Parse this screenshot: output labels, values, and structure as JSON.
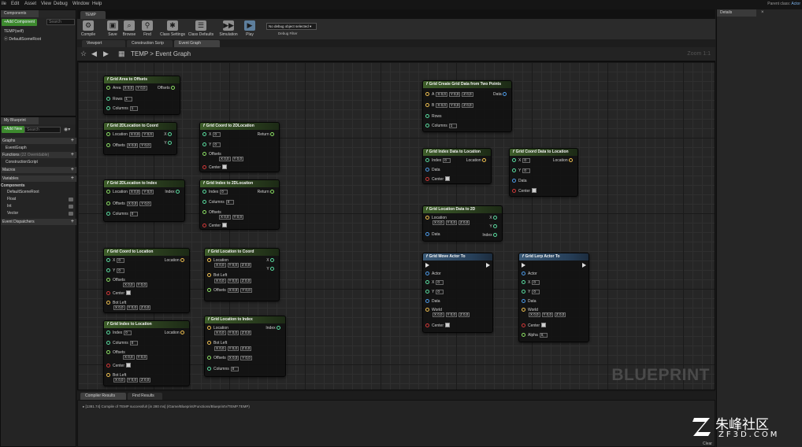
{
  "menu": [
    "ile",
    "Edit",
    "Asset",
    "View",
    "Debug",
    "Window",
    "Help"
  ],
  "title_right": {
    "label": "Parent class:",
    "value": "Actor"
  },
  "components_panel": {
    "tab": "Components",
    "add_button": "+Add Component",
    "search_placeholder": "Search",
    "items": [
      "TEMP(self)",
      "DefaultSceneRoot"
    ]
  },
  "myblueprint_panel": {
    "tab": "My Blueprint",
    "add_button": "+Add New",
    "search_placeholder": "Search",
    "sections": {
      "graphs": "Graphs",
      "event_graph": "EventGraph",
      "functions": "Functions",
      "functions_count": "(22 Overridable)",
      "construction_script": "ConstructionScript",
      "macros": "Macros",
      "variables": "Variables",
      "components": "Components",
      "default_scene_root": "DefaultSceneRoot",
      "var_float": "Float",
      "var_int": "Int",
      "var_vector": "Vector",
      "event_dispatchers": "Event Dispatchers"
    }
  },
  "editor_tab": "TEMP",
  "toolbar": [
    {
      "icon": "compile-icon",
      "label": "Compile"
    },
    {
      "icon": "save-icon",
      "label": "Save"
    },
    {
      "icon": "browse-icon",
      "label": "Browse"
    },
    {
      "icon": "find-icon",
      "label": "Find"
    },
    {
      "icon": "class-settings-icon",
      "label": "Class Settings"
    },
    {
      "icon": "class-defaults-icon",
      "label": "Class Defaults"
    },
    {
      "icon": "simulation-icon",
      "label": "Simulation"
    },
    {
      "icon": "play-icon",
      "label": "Play"
    }
  ],
  "debug": {
    "selected": "No debug object selected",
    "label": "Debug Filter"
  },
  "graph_tabs": [
    "Viewport",
    "Construction Scrip",
    "Event Graph"
  ],
  "breadcrumb": "TEMP > Event Graph",
  "zoom": "Zoom 1:1",
  "watermark": "BLUEPRINT",
  "nodes": {
    "area_to_offsets": {
      "title": "Grid Area to Offsets",
      "area": "Area",
      "area_x": "X 0,0",
      "area_y": "Y 0,0",
      "offsets": "Offsets",
      "rows": "Rows",
      "rows_v": "1",
      "columns": "Columns",
      "columns_v": "1"
    },
    "loc2d_to_coord": {
      "title": "Grid 2DLocation to Coord",
      "location": "Location",
      "loc_x": "X 0,0",
      "loc_y": "Y 0,0",
      "offsets": "Offsets",
      "off_x": "X 0,0",
      "off_y": "Y 0,0",
      "out_x": "X",
      "out_y": "Y"
    },
    "coord_to_2dloc": {
      "title": "Grid Coord to 2DLocation",
      "x": "X",
      "x_v": "0",
      "y": "Y",
      "y_v": "0",
      "offsets": "Offsets",
      "off_x": "X 0,0",
      "off_y": "Y 0,0",
      "center": "Center",
      "ret": "Return"
    },
    "loc2d_to_index": {
      "title": "Grid 2DLocation to Index",
      "location": "Location",
      "loc_x": "X 0,0",
      "loc_y": "Y 0,0",
      "offsets": "Offsets",
      "off_x": "X 0,0",
      "off_y": "Y 0,0",
      "columns": "Columns",
      "columns_v": "0",
      "index": "Index"
    },
    "index_to_2dloc": {
      "title": "Grid Index to 2DLocation",
      "index": "Index",
      "index_v": "0",
      "columns": "Columns",
      "columns_v": "0",
      "offsets": "Offsets",
      "off_x": "X 0,0",
      "off_y": "Y 0,0",
      "center": "Center",
      "ret": "Return"
    },
    "coord_to_location": {
      "title": "Grid Coord to Location",
      "x": "X",
      "x_v": "0",
      "y": "Y",
      "y_v": "0",
      "offsets": "Offsets",
      "off_x": "X 0,0",
      "off_y": "Y 0,0",
      "center": "Center",
      "botleft": "Bot Left",
      "bl_x": "X 0,0",
      "bl_y": "Y 0,0",
      "bl_z": "Z 0,0",
      "location": "Location"
    },
    "location_to_coord": {
      "title": "Grid Location to Coord",
      "location": "Location",
      "loc_x": "X 0,0",
      "loc_y": "Y 0,0",
      "loc_z": "Z 0,0",
      "botleft": "Bot Left",
      "bl_x": "X 0,0",
      "bl_y": "Y 0,0",
      "bl_z": "Z 0,0",
      "offsets": "Offsets",
      "off_x": "X 0,0",
      "off_y": "Y 0,0",
      "out_x": "X",
      "out_y": "Y"
    },
    "index_to_location": {
      "title": "Grid Index to Location",
      "index": "Index",
      "index_v": "0",
      "columns": "Columns",
      "columns_v": "0",
      "offsets": "Offsets",
      "off_x": "X 0,0",
      "off_y": "Y 0,0",
      "center": "Center",
      "botleft": "Bot Left",
      "bl_x": "X 0,0",
      "bl_y": "Y 0,0",
      "bl_z": "Z 0,0",
      "location": "Location"
    },
    "location_to_index": {
      "title": "Grid Location to Index",
      "location": "Location",
      "loc_x": "X 0,0",
      "loc_y": "Y 0,0",
      "loc_z": "Z 0,0",
      "botleft": "Bot Left",
      "bl_x": "X 0,0",
      "bl_y": "Y 0,0",
      "bl_z": "Z 0,0",
      "offsets": "Offsets",
      "off_x": "X 0,0",
      "off_y": "Y 0,0",
      "columns": "Columns",
      "columns_v": "0",
      "index": "Index"
    },
    "create_grid_data": {
      "title": "Grid Create Grid Data from Two Points",
      "a": "A",
      "a_x": "X 0,0",
      "a_y": "Y 0,0",
      "a_z": "Z 0,0",
      "b": "B",
      "b_x": "X 0,0",
      "b_y": "Y 0,0",
      "b_z": "Z 0,0",
      "rows": "Rows",
      "rows_v": "1",
      "columns": "Columns",
      "columns_v": "1",
      "data": "Data"
    },
    "index_data_to_location": {
      "title": "Grid Index Data to Location",
      "index": "Index",
      "index_v": "0",
      "data": "Data",
      "center": "Center",
      "location": "Location"
    },
    "coord_data_to_location": {
      "title": "Grid Coord Data to Location",
      "x": "X",
      "x_v": "0",
      "y": "Y",
      "y_v": "0",
      "data": "Data",
      "center": "Center",
      "location": "Location"
    },
    "location_data_to_2d": {
      "title": "Grid Location Data to 2D",
      "location": "Location",
      "loc_x": "X 0,0",
      "loc_y": "Y 0,0",
      "loc_z": "Z 0,0",
      "data": "Data",
      "out_x": "X",
      "out_y": "Y",
      "index": "Index"
    },
    "move_actor_to": {
      "title": "Grid Move Actor To",
      "actor": "Actor",
      "x": "X",
      "x_v": "0",
      "y": "Y",
      "y_v": "0",
      "data": "Data",
      "world": "World",
      "w_x": "X 0,0",
      "w_y": "Y 0,0",
      "w_z": "Z 0,0",
      "center": "Center"
    },
    "lerp_actor_to": {
      "title": "Grid Lerp Actor To",
      "actor": "Actor",
      "x": "X",
      "x_v": "0",
      "y": "Y",
      "y_v": "0",
      "data": "Data",
      "world": "World",
      "w_x": "X 0,0",
      "w_y": "Y 0,0",
      "w_z": "Z 0,0",
      "center": "Center",
      "alpha": "Alpha",
      "alpha_v": "0,"
    }
  },
  "details_tab": "Details",
  "bottom_tabs": [
    "Compiler Results",
    "Find Results"
  ],
  "log_line": "[1381.74] Compile of TEMP successful! [in 280 ms] (/Game/Blueprint/Functions/BlueprintV/TEMP.TEMP)",
  "clear_label": "Clear",
  "logo": {
    "cn": "朱峰社区",
    "en": "ZF3D.COM"
  }
}
